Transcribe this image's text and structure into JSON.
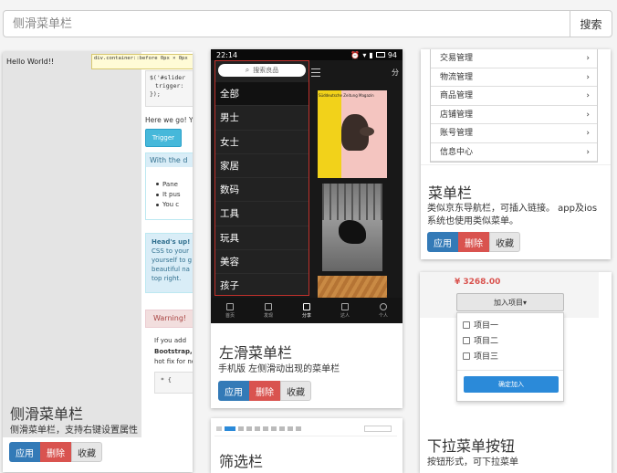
{
  "search": {
    "placeholder": "侧滑菜单栏",
    "button": "搜索"
  },
  "buttons": {
    "apply": "应用",
    "delete": "删除",
    "favorite": "收藏"
  },
  "card1": {
    "title": "侧滑菜单栏",
    "desc": "侧滑菜单栏，支持右键设置属性",
    "shot": {
      "hello": "Hello World!!",
      "tooltip": "div.container::before 0px × 0px",
      "code1": "$('#slider",
      "code2": "trigger:",
      "code3": "});",
      "here": "Here we go! Y",
      "trigger": "Trigger",
      "with": "With the d",
      "bullets": [
        "Pane",
        "It pus",
        "You c"
      ],
      "heads_title": "Head's up!",
      "heads_lines": [
        "CSS to your",
        "yourself to g",
        "beautiful na",
        "top right."
      ],
      "warning": "Warning!",
      "ifyou": "If you add",
      "bootstrap": "Bootstrap,",
      "hotfix": "hot fix for no",
      "brace": "* {"
    }
  },
  "card2": {
    "title": "左滑菜单栏",
    "desc": "手机版 左侧滑动出现的菜单栏",
    "time": "22:14",
    "battery": "94",
    "search_text": "搜索良品",
    "menu": [
      "全部",
      "男士",
      "女士",
      "家居",
      "数码",
      "工具",
      "玩具",
      "美容",
      "孩子"
    ],
    "tabs": [
      "首页",
      "发现",
      "分享",
      "达人",
      "个人"
    ],
    "share": "分",
    "magazine": "Süddeutsche Zeitung Magazin"
  },
  "card3": {
    "title": "菜单栏",
    "desc": "类似京东导航栏，可插入链接。 app及ios系统也使用类似菜单。",
    "items": [
      "交易管理",
      "物流管理",
      "商品管理",
      "店铺管理",
      "账号管理",
      "信息中心"
    ]
  },
  "card4": {
    "title": "下拉菜单按钮",
    "desc": "按钮形式，可下拉菜单",
    "price": "¥ 3268.00",
    "dd_label": "加入项目▾",
    "options": [
      "项目一",
      "项目二",
      "项目三"
    ],
    "confirm": "确定加入"
  },
  "card5": {
    "title": "筛选栏"
  }
}
